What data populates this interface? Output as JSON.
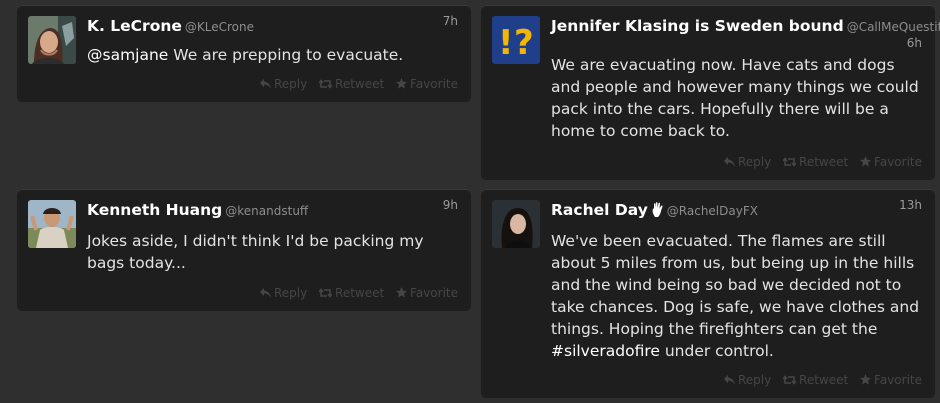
{
  "tweets": [
    {
      "name": "K. LeCrone",
      "handle": "@KLeCrone",
      "time": "7h",
      "mention": "@samjane",
      "text": " We are prepping to evacuate."
    },
    {
      "name": "Jennifer Klasing is Sweden bound",
      "handle": "@CallMeQuestifer",
      "time": "6h",
      "text": "We are evacuating now. Have cats and dogs and people and however many things we could pack into the cars. Hopefully there will be a home to come back to."
    },
    {
      "name": "Kenneth Huang",
      "handle": "@kenandstuff",
      "time": "9h",
      "text": "Jokes aside, I didn't think I'd be packing my bags today..."
    },
    {
      "name": "Rachel Day",
      "handle": "@RachelDayFX",
      "time": "13h",
      "text_before": "We've been evacuated. The flames are still about 5 miles from us, but being up in the hills and the wind being so bad we decided not to take chances. Dog is safe, we have clothes and things. Hoping the firefighters can get the ",
      "hashtag": "#silveradofire",
      "text_after": " under control."
    }
  ],
  "actions": {
    "reply": "Reply",
    "retweet": "Retweet",
    "favorite": "Favorite"
  },
  "icons": {
    "reply": "reply-arrow-icon",
    "retweet": "retweet-icon",
    "favorite": "star-icon",
    "hand": "hand-icon"
  },
  "colors": {
    "background": "#2f2f2f",
    "card": "#1e1e1e",
    "name": "#ffffff",
    "text": "#e3e3e3",
    "muted": "#8d8d8d",
    "action": "#464646"
  }
}
